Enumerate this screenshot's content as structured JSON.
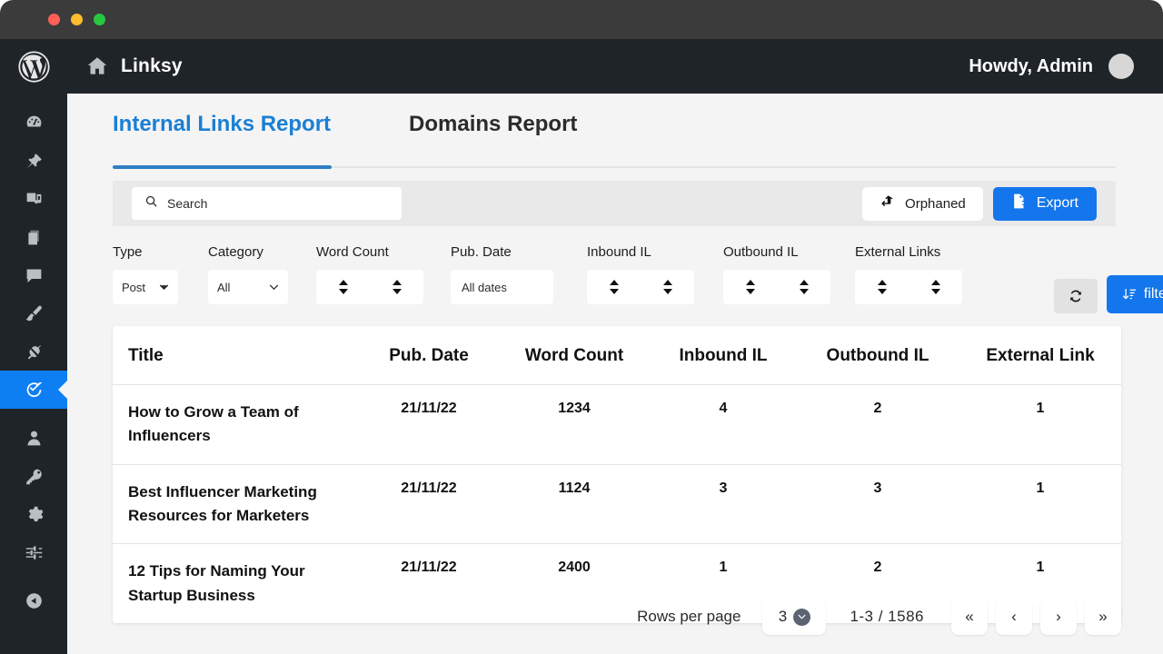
{
  "window": {
    "traffic_lights": [
      "close",
      "minimize",
      "maximize"
    ]
  },
  "adminbar": {
    "wp_logo_icon": "wordpress-icon",
    "home_icon": "home-icon",
    "site_name": "Linksy",
    "howdy": "Howdy, Admin",
    "avatar_icon": "avatar"
  },
  "sidebar": {
    "items": [
      {
        "name": "dashboard",
        "icon": "dashboard-icon",
        "active": false
      },
      {
        "name": "posts",
        "icon": "pin-icon",
        "active": false
      },
      {
        "name": "media",
        "icon": "media-icon",
        "active": false
      },
      {
        "name": "pages",
        "icon": "pages-icon",
        "active": false
      },
      {
        "name": "comments",
        "icon": "comment-icon",
        "active": false
      },
      {
        "name": "appearance",
        "icon": "paintbrush-icon",
        "active": false
      },
      {
        "name": "plugins",
        "icon": "plug-icon",
        "active": false
      },
      {
        "name": "linksy",
        "icon": "check-circle-icon",
        "active": true
      },
      {
        "name": "users",
        "icon": "user-icon",
        "active": false
      },
      {
        "name": "tools",
        "icon": "key-icon",
        "active": false
      },
      {
        "name": "settings",
        "icon": "gear-icon",
        "active": false
      },
      {
        "name": "options",
        "icon": "sliders-icon",
        "active": false
      },
      {
        "name": "collapse",
        "icon": "collapse-icon",
        "active": false
      }
    ]
  },
  "main": {
    "tabs": [
      {
        "label": "Internal Links Report",
        "active": true
      },
      {
        "label": "Domains Report",
        "active": false
      }
    ],
    "search": {
      "icon": "search-icon",
      "value": "",
      "placeholder": "Search"
    },
    "orphaned_button": {
      "label": "Orphaned",
      "icon": "orphaned-arrow-icon"
    },
    "export_button": {
      "label": "Export",
      "icon": "export-file-icon"
    },
    "filters": [
      {
        "name": "type",
        "label": "Type",
        "control": "select",
        "value": "Post"
      },
      {
        "name": "category",
        "label": "Category",
        "control": "select",
        "value": "All"
      },
      {
        "name": "word-count",
        "label": "Word Count",
        "control": "spinner-range"
      },
      {
        "name": "pub-date",
        "label": "Pub. Date",
        "control": "date",
        "value": "All dates"
      },
      {
        "name": "inbound-il",
        "label": "Inbound IL",
        "control": "spinner-range"
      },
      {
        "name": "outbound-il",
        "label": "Outbound IL",
        "control": "spinner-range"
      },
      {
        "name": "external-links",
        "label": "External Links",
        "control": "spinner-range"
      }
    ],
    "refresh_button": {
      "icon": "refresh-icon"
    },
    "filter_button": {
      "label": "filter",
      "icon": "sort-descending-icon"
    },
    "table": {
      "columns": [
        "Title",
        "Pub. Date",
        "Word Count",
        "Inbound IL",
        "Outbound IL",
        "External Link"
      ],
      "rows": [
        {
          "title": "How to Grow a Team of Influencers",
          "pub_date": "21/11/22",
          "word_count": "1234",
          "inbound_il": "4",
          "outbound_il": "2",
          "external_link": "1"
        },
        {
          "title": "Best Influencer Marketing Resources for Marketers",
          "pub_date": "21/11/22",
          "word_count": "1124",
          "inbound_il": "3",
          "outbound_il": "3",
          "external_link": "1"
        },
        {
          "title": "12 Tips for Naming Your Startup Business",
          "pub_date": "21/11/22",
          "word_count": "2400",
          "inbound_il": "1",
          "outbound_il": "2",
          "external_link": "1"
        }
      ]
    },
    "pagination": {
      "rows_per_page_label": "Rows per page",
      "rows_per_page_value": "3",
      "range_text": "1-3 / 1586",
      "first_label": "«",
      "prev_label": "‹",
      "next_label": "›",
      "last_label": "»"
    }
  },
  "colors": {
    "accent_blue": "#1376ec",
    "tab_blue": "#1a7fd4",
    "sidebar_dark": "#1f2429",
    "titlebar": "#3b3b3b",
    "page_bg": "#f4f4f5",
    "strip_bg": "#e9e9ea"
  }
}
